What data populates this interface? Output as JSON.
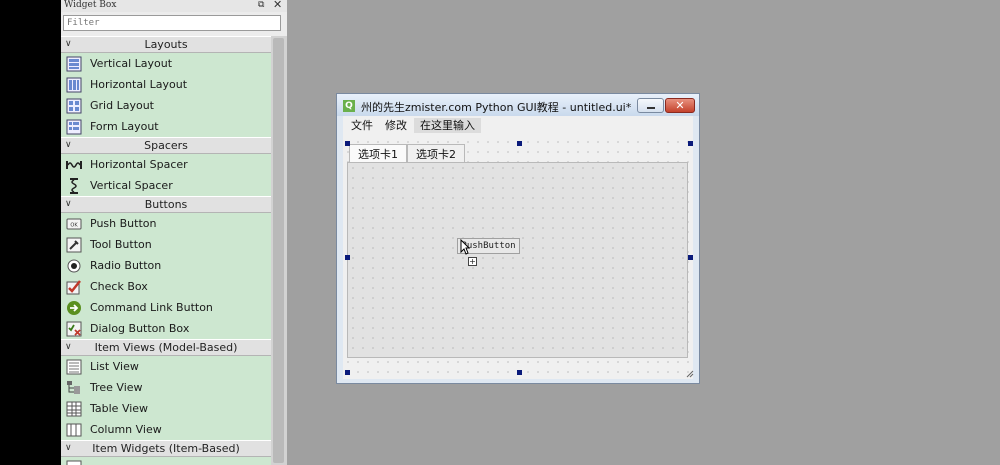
{
  "widget_box": {
    "title": "Widget Box",
    "filter_placeholder": "Filter",
    "close_glyph": "✕",
    "float_glyph": "⧉",
    "categories": [
      {
        "label": "Layouts",
        "items": [
          "Vertical Layout",
          "Horizontal Layout",
          "Grid Layout",
          "Form Layout"
        ]
      },
      {
        "label": "Spacers",
        "items": [
          "Horizontal Spacer",
          "Vertical Spacer"
        ]
      },
      {
        "label": "Buttons",
        "items": [
          "Push Button",
          "Tool Button",
          "Radio Button",
          "Check Box",
          "Command Link Button",
          "Dialog Button Box"
        ]
      },
      {
        "label": "Item Views (Model-Based)",
        "items": [
          "List View",
          "Tree View",
          "Table View",
          "Column View"
        ]
      },
      {
        "label": "Item Widgets (Item-Based)",
        "items": [
          ""
        ]
      }
    ]
  },
  "form_window": {
    "title": "州的先生zmister.com Python GUI教程 - untitled.ui*",
    "app_icon_letter": "Q",
    "menus": [
      "文件",
      "修改",
      "在这里输入"
    ],
    "tabs": [
      "选项卡1",
      "选项卡2"
    ],
    "push_button": "PushButton",
    "close_glyph": "✕"
  }
}
